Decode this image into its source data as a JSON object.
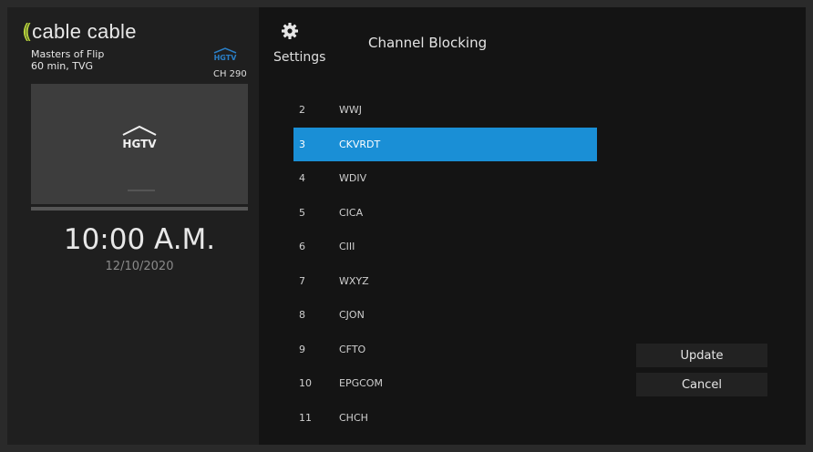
{
  "brand": {
    "waves": "((",
    "name": "cable cable",
    "accent": "#b6d23c"
  },
  "now_playing": {
    "title": "Masters of Flip",
    "meta": "60 min, TVG",
    "network_icon": "hgtv-logo",
    "channel": "CH 290"
  },
  "clock": {
    "time": "10:00 A.M.",
    "date": "12/10/2020"
  },
  "header": {
    "section_label": "Settings",
    "section_icon": "gear-icon",
    "title": "Channel Blocking"
  },
  "channels": [
    {
      "num": "2",
      "name": "WWJ"
    },
    {
      "num": "3",
      "name": "CKVRDT",
      "selected": true
    },
    {
      "num": "4",
      "name": "WDIV"
    },
    {
      "num": "5",
      "name": "CICA"
    },
    {
      "num": "6",
      "name": "CIII"
    },
    {
      "num": "7",
      "name": "WXYZ"
    },
    {
      "num": "8",
      "name": "CJON"
    },
    {
      "num": "9",
      "name": "CFTO"
    },
    {
      "num": "10",
      "name": "EPGCOM"
    },
    {
      "num": "11",
      "name": "CHCH"
    }
  ],
  "actions": {
    "update": "Update",
    "cancel": "Cancel"
  },
  "colors": {
    "selection": "#1a8fd6",
    "left_panel": "#1f1f1f",
    "right_panel": "#141414"
  }
}
